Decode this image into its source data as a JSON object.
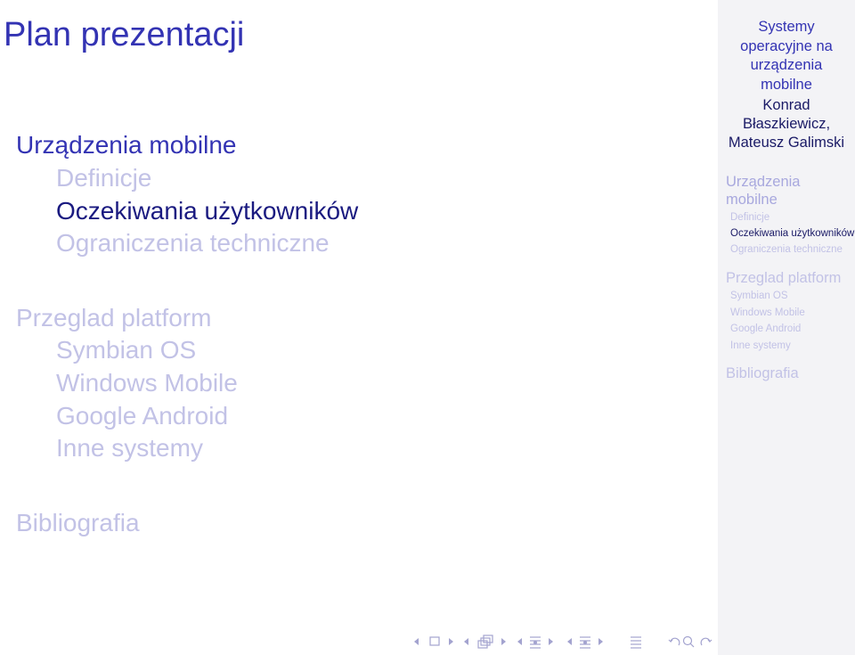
{
  "slide": {
    "title": "Plan prezentacji"
  },
  "toc": {
    "sections": [
      {
        "label": "Urządzenia mobilne",
        "subsections": [
          "Definicje",
          "Oczekiwania użytkowników",
          "Ograniczenia techniczne"
        ]
      },
      {
        "label": "Przeglad platform",
        "subsections": [
          "Symbian OS",
          "Windows Mobile",
          "Google Android",
          "Inne systemy"
        ]
      },
      {
        "label": "Bibliografia",
        "subsections": []
      }
    ]
  },
  "sidebar": {
    "title_lines": [
      "Systemy",
      "operacyjne na",
      "urządzenia",
      "mobilne"
    ],
    "author_lines": [
      "Konrad",
      "Błaszkiewicz,",
      "Mateusz Galimski"
    ],
    "sections": [
      {
        "label_lines": [
          "Urządzenia",
          "mobilne"
        ],
        "subsections": [
          "Definicje",
          "Oczekiwania użytkowników",
          "Ograniczenia techniczne"
        ]
      },
      {
        "label_lines": [
          "Przeglad platform"
        ],
        "subsections": [
          "Symbian OS",
          "Windows Mobile",
          "Google Android",
          "Inne systemy"
        ]
      },
      {
        "label_lines": [
          "Bibliografia"
        ],
        "subsections": []
      }
    ]
  },
  "navigation": {
    "icons": [
      "arrow-left-icon",
      "frame-icon",
      "arrow-right-icon",
      "arrow-left-icon",
      "subsection-icon",
      "arrow-right-icon",
      "arrow-left-icon",
      "section-icon",
      "arrow-right-icon",
      "arrow-left-icon",
      "section-icon",
      "arrow-right-icon",
      "appendix-icon",
      "undo-icon",
      "search-icon",
      "redo-icon"
    ]
  },
  "colors": {
    "accent": "#3333b3",
    "faded": "#c2c2e6",
    "active_sub": "#1a1a80",
    "sidebar_bg": "#f3f3f6",
    "nav": "#a3a3cf"
  }
}
